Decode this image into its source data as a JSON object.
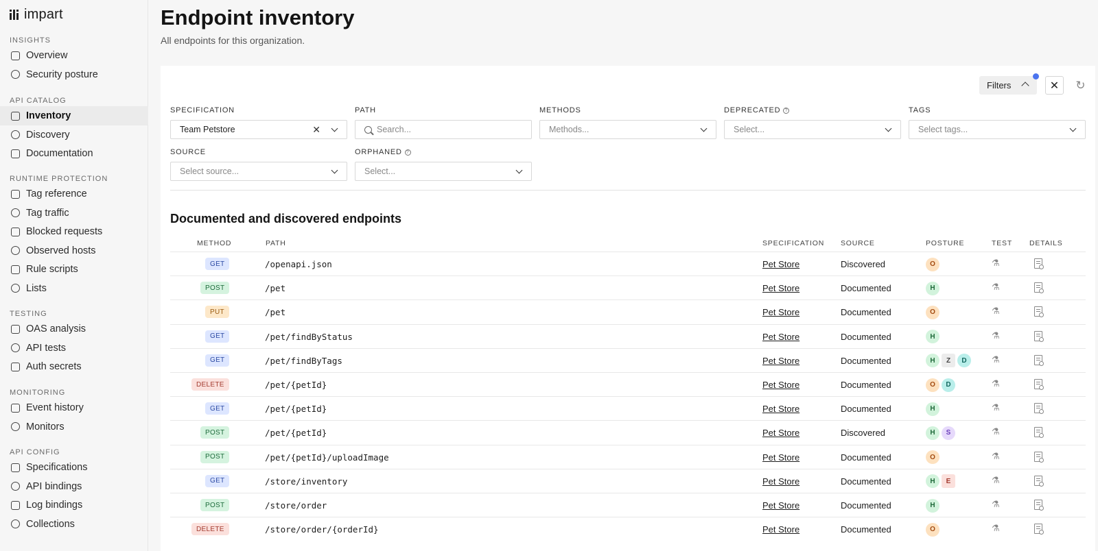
{
  "app": {
    "logo_text": "impart"
  },
  "sidebar": {
    "sections": [
      {
        "label": "INSIGHTS",
        "items": [
          {
            "label": "Overview",
            "icon": "home-icon"
          },
          {
            "label": "Security posture",
            "icon": "eye-icon"
          }
        ]
      },
      {
        "label": "API CATALOG",
        "items": [
          {
            "label": "Inventory",
            "icon": "inventory-icon",
            "active": true
          },
          {
            "label": "Discovery",
            "icon": "lightbulb-icon"
          },
          {
            "label": "Documentation",
            "icon": "document-icon"
          }
        ]
      },
      {
        "label": "RUNTIME PROTECTION",
        "items": [
          {
            "label": "Tag reference",
            "icon": "book-icon"
          },
          {
            "label": "Tag traffic",
            "icon": "tag-icon"
          },
          {
            "label": "Blocked requests",
            "icon": "shield-icon"
          },
          {
            "label": "Observed hosts",
            "icon": "diamond-icon"
          },
          {
            "label": "Rule scripts",
            "icon": "clipboard-icon"
          },
          {
            "label": "Lists",
            "icon": "list-icon"
          }
        ]
      },
      {
        "label": "TESTING",
        "items": [
          {
            "label": "OAS analysis",
            "icon": "check-circle-icon"
          },
          {
            "label": "API tests",
            "icon": "flask-icon"
          },
          {
            "label": "Auth secrets",
            "icon": "lock-icon"
          }
        ]
      },
      {
        "label": "MONITORING",
        "items": [
          {
            "label": "Event history",
            "icon": "calendar-icon"
          },
          {
            "label": "Monitors",
            "icon": "monitor-icon"
          }
        ]
      },
      {
        "label": "API CONFIG",
        "items": [
          {
            "label": "Specifications",
            "icon": "spec-icon"
          },
          {
            "label": "API bindings",
            "icon": "arrows-icon"
          },
          {
            "label": "Log bindings",
            "icon": "log-icon"
          },
          {
            "label": "Collections",
            "icon": "collection-icon"
          }
        ]
      }
    ]
  },
  "header": {
    "title": "Endpoint inventory",
    "subtitle": "All endpoints for this organization."
  },
  "filters": {
    "button_label": "Filters",
    "specification": {
      "label": "SPECIFICATION",
      "value": "Team Petstore"
    },
    "path": {
      "label": "PATH",
      "placeholder": "Search..."
    },
    "methods": {
      "label": "METHODS",
      "placeholder": "Methods..."
    },
    "deprecated": {
      "label": "DEPRECATED",
      "placeholder": "Select..."
    },
    "tags": {
      "label": "TAGS",
      "placeholder": "Select tags..."
    },
    "source": {
      "label": "SOURCE",
      "placeholder": "Select source..."
    },
    "orphaned": {
      "label": "ORPHANED",
      "placeholder": "Select..."
    }
  },
  "table": {
    "title": "Documented and discovered endpoints",
    "columns": {
      "method": "METHOD",
      "path": "PATH",
      "specification": "SPECIFICATION",
      "source": "SOURCE",
      "posture": "POSTURE",
      "test": "TEST",
      "details": "DETAILS"
    },
    "rows": [
      {
        "method": "GET",
        "path": "/openapi.json",
        "spec": "Pet Store",
        "source": "Discovered",
        "posture": [
          "O"
        ]
      },
      {
        "method": "POST",
        "path": "/pet",
        "spec": "Pet Store",
        "source": "Documented",
        "posture": [
          "H"
        ]
      },
      {
        "method": "PUT",
        "path": "/pet",
        "spec": "Pet Store",
        "source": "Documented",
        "posture": [
          "O"
        ]
      },
      {
        "method": "GET",
        "path": "/pet/findByStatus",
        "spec": "Pet Store",
        "source": "Documented",
        "posture": [
          "H"
        ]
      },
      {
        "method": "GET",
        "path": "/pet/findByTags",
        "spec": "Pet Store",
        "source": "Documented",
        "posture": [
          "H",
          "Z",
          "D"
        ]
      },
      {
        "method": "DELETE",
        "path": "/pet/{petId}",
        "spec": "Pet Store",
        "source": "Documented",
        "posture": [
          "O",
          "D"
        ]
      },
      {
        "method": "GET",
        "path": "/pet/{petId}",
        "spec": "Pet Store",
        "source": "Documented",
        "posture": [
          "H"
        ]
      },
      {
        "method": "POST",
        "path": "/pet/{petId}",
        "spec": "Pet Store",
        "source": "Discovered",
        "posture": [
          "H",
          "S"
        ]
      },
      {
        "method": "POST",
        "path": "/pet/{petId}/uploadImage",
        "spec": "Pet Store",
        "source": "Documented",
        "posture": [
          "O"
        ]
      },
      {
        "method": "GET",
        "path": "/store/inventory",
        "spec": "Pet Store",
        "source": "Documented",
        "posture": [
          "H",
          "E"
        ]
      },
      {
        "method": "POST",
        "path": "/store/order",
        "spec": "Pet Store",
        "source": "Documented",
        "posture": [
          "H"
        ]
      },
      {
        "method": "DELETE",
        "path": "/store/order/{orderId}",
        "spec": "Pet Store",
        "source": "Documented",
        "posture": [
          "O"
        ]
      }
    ]
  }
}
